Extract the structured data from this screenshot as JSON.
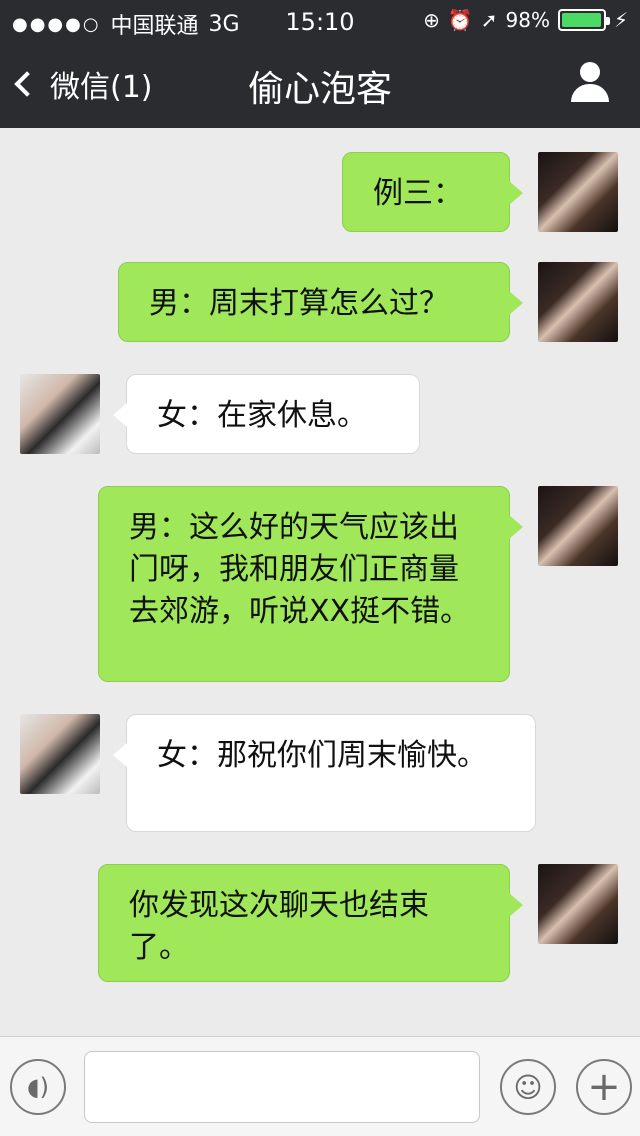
{
  "status_bar": {
    "signal": "●●●●○",
    "carrier": "中国联通",
    "network": "3G",
    "time": "15:10",
    "battery_percent": "98%",
    "battery_level": 0.98
  },
  "nav": {
    "back_label": "微信(1)",
    "title": "偷心泡客"
  },
  "messages": [
    {
      "side": "out",
      "text": "例三："
    },
    {
      "side": "out",
      "text": "男：周末打算怎么过？"
    },
    {
      "side": "in",
      "text": "女：在家休息。"
    },
    {
      "side": "out",
      "text": "男：这么好的天气应该出门呀，我和朋友们正商量去郊游，听说XX挺不错。"
    },
    {
      "side": "in",
      "text": "女：那祝你们周末愉快。"
    },
    {
      "side": "out",
      "text": "你发现这次聊天也结束了。"
    }
  ],
  "input_bar": {
    "message_placeholder": ""
  },
  "colors": {
    "header_bg": "#2b2c30",
    "outgoing_bubble": "#a0e75a",
    "incoming_bubble": "#ffffff",
    "chat_bg": "#ebebeb"
  },
  "icons": [
    "back-chevron-icon",
    "profile-icon",
    "voice-icon",
    "emoji-icon",
    "plus-icon"
  ]
}
